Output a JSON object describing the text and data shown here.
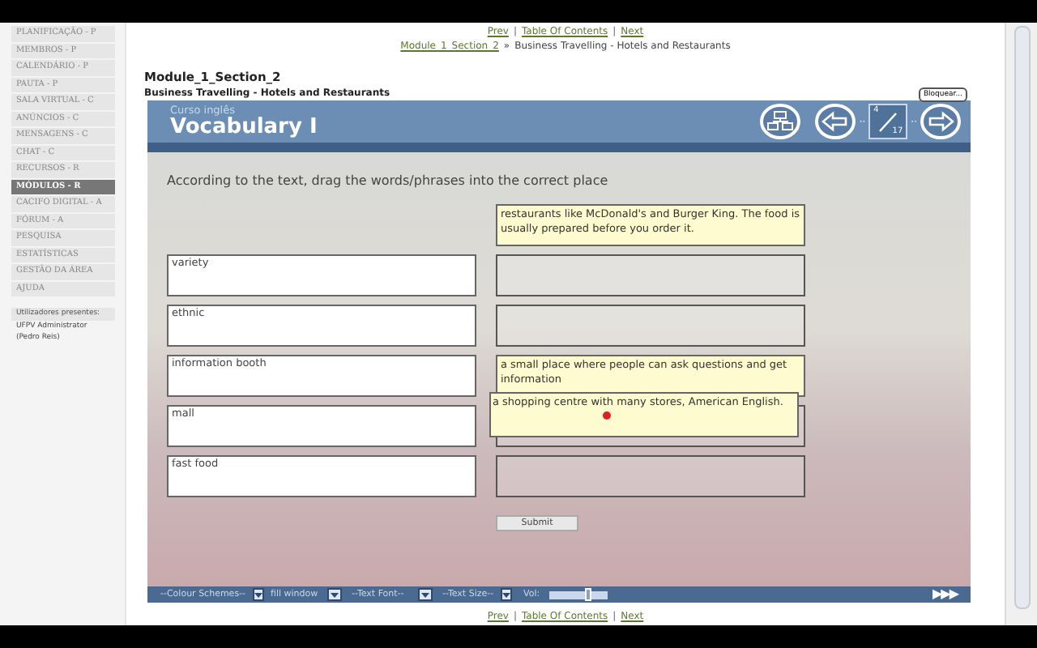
{
  "sidebar": {
    "items": [
      {
        "label": "PLANIFICAÇÃO - P",
        "selected": false
      },
      {
        "label": "MEMBROS - P",
        "selected": false
      },
      {
        "label": "CALENDÁRIO - P",
        "selected": false
      },
      {
        "label": "PAUTA - P",
        "selected": false
      },
      {
        "label": "SALA VIRTUAL - C",
        "selected": false
      },
      {
        "label": "ANÚNCIOS - C",
        "selected": false
      },
      {
        "label": "MENSAGENS - C",
        "selected": false
      },
      {
        "label": "CHAT - C",
        "selected": false
      },
      {
        "label": "RECURSOS - R",
        "selected": false
      },
      {
        "label": "MÓDULOS - R",
        "selected": true
      },
      {
        "label": "CACIFO DIGITAL - A",
        "selected": false
      },
      {
        "label": "FÓRUM - A",
        "selected": false
      },
      {
        "label": "PESQUISA",
        "selected": false
      },
      {
        "label": "ESTATÍSTICAS",
        "selected": false
      },
      {
        "label": "GESTÃO DA ÁREA",
        "selected": false
      },
      {
        "label": "AJUDA",
        "selected": false
      }
    ],
    "users_heading": "Utilizadores presentes:",
    "users": [
      "UFPV Administrator",
      "(Pedro Reis)"
    ]
  },
  "top_nav": [
    "Prev",
    "|",
    "Table Of Contents",
    "|",
    "Next"
  ],
  "breadcrumb": {
    "link": "Module_1_Section_2",
    "separator": "»",
    "current": "Business Travelling - Hotels and Restaurants"
  },
  "module_title": "Module_1_Section_2",
  "module_subtitle": "Business Travelling - Hotels and Restaurants",
  "course": {
    "brand": "Curso inglês",
    "title": "Vocabulary I",
    "lock_button": "Bloquear...",
    "page_current": "4",
    "page_total": "17",
    "instruction": "According to the text, drag the words/phrases into the correct place",
    "words": [
      "variety",
      "ethnic",
      "information booth",
      "mall",
      "fast food"
    ],
    "targets": [
      {
        "filled": true,
        "text": "restaurants like McDonald's and Burger King. The food is usually prepared before you order it."
      },
      {
        "filled": false
      },
      {
        "filled": false
      },
      {
        "filled": true,
        "text": "a small place where people can ask questions and get information"
      },
      {
        "filled": false
      },
      {
        "filled": false
      }
    ],
    "nav_dots": [
      "··",
      "··"
    ],
    "dragged": "a shopping centre with many stores, American English.",
    "submit": "Submit",
    "toolbar": {
      "selects": [
        "--Colour Schemes--",
        "fill window",
        "--Text Font--",
        "--Text Size--"
      ],
      "volume_label": "Vol:",
      "volume": {
        "level": 0.68
      },
      "play": "▶▶▶"
    }
  },
  "bottom_nav": [
    "Prev",
    "|",
    "Table Of Contents",
    "|",
    "Next"
  ]
}
